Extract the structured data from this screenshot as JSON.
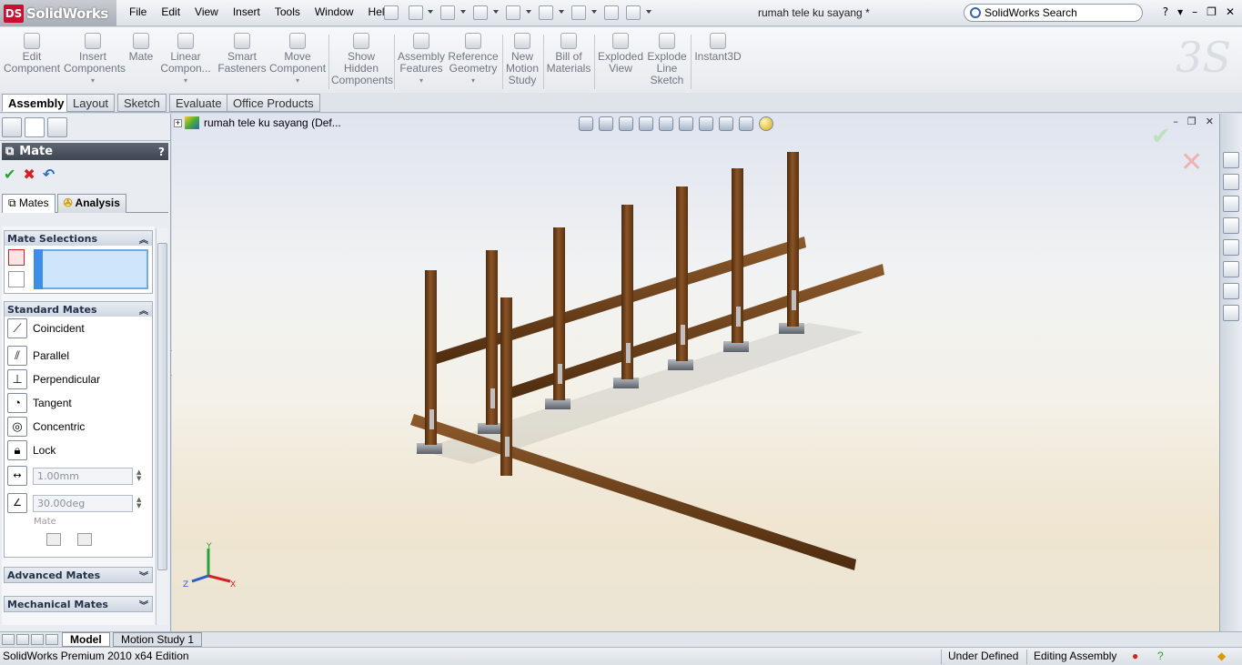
{
  "app": {
    "brand_letters": "DS",
    "brand_name": "SolidWorks"
  },
  "menu": [
    "File",
    "Edit",
    "View",
    "Insert",
    "Tools",
    "Window",
    "Help"
  ],
  "title": "rumah tele ku sayang *",
  "search": {
    "placeholder": "SolidWorks Search"
  },
  "window_controls": [
    "?",
    "▾",
    "–",
    "❐",
    "✕"
  ],
  "commands": [
    {
      "label": "Edit\nComponent"
    },
    {
      "label": "Insert\nComponents"
    },
    {
      "label": "Mate"
    },
    {
      "label": "Linear\nCompon..."
    },
    {
      "label": "Smart\nFasteners"
    },
    {
      "label": "Move\nComponent"
    },
    {
      "label": "Show\nHidden\nComponents"
    },
    {
      "label": "Assembly\nFeatures"
    },
    {
      "label": "Reference\nGeometry"
    },
    {
      "label": "New\nMotion\nStudy"
    },
    {
      "label": "Bill of\nMaterials"
    },
    {
      "label": "Exploded\nView"
    },
    {
      "label": "Explode\nLine\nSketch"
    },
    {
      "label": "Instant3D"
    }
  ],
  "cmd_tabs": [
    "Assembly",
    "Layout",
    "Sketch",
    "Evaluate",
    "Office Products"
  ],
  "property_manager": {
    "title": "Mate",
    "help": "?",
    "tabs": {
      "mates": "Mates",
      "analysis": "Analysis"
    },
    "groups": {
      "selections": "Mate Selections",
      "standard": "Standard Mates",
      "advanced": "Advanced Mates",
      "mechanical": "Mechanical Mates"
    },
    "standard_mates": [
      "Coincident",
      "Parallel",
      "Perpendicular",
      "Tangent",
      "Concentric",
      "Lock"
    ],
    "distance_value": "1.00mm",
    "angle_value": "30.00deg",
    "mate_alignment_label": "Mate"
  },
  "tree": {
    "root": "rumah tele ku sayang  (Def..."
  },
  "bottom_tabs": [
    "Model",
    "Motion Study 1"
  ],
  "status": {
    "edition": "SolidWorks Premium 2010 x64 Edition",
    "state": "Under Defined",
    "mode": "Editing Assembly"
  },
  "colors": {
    "wood": "#7a4a1f",
    "accent": "#3d8ee6",
    "ok": "#27a336",
    "cancel": "#d42020"
  }
}
